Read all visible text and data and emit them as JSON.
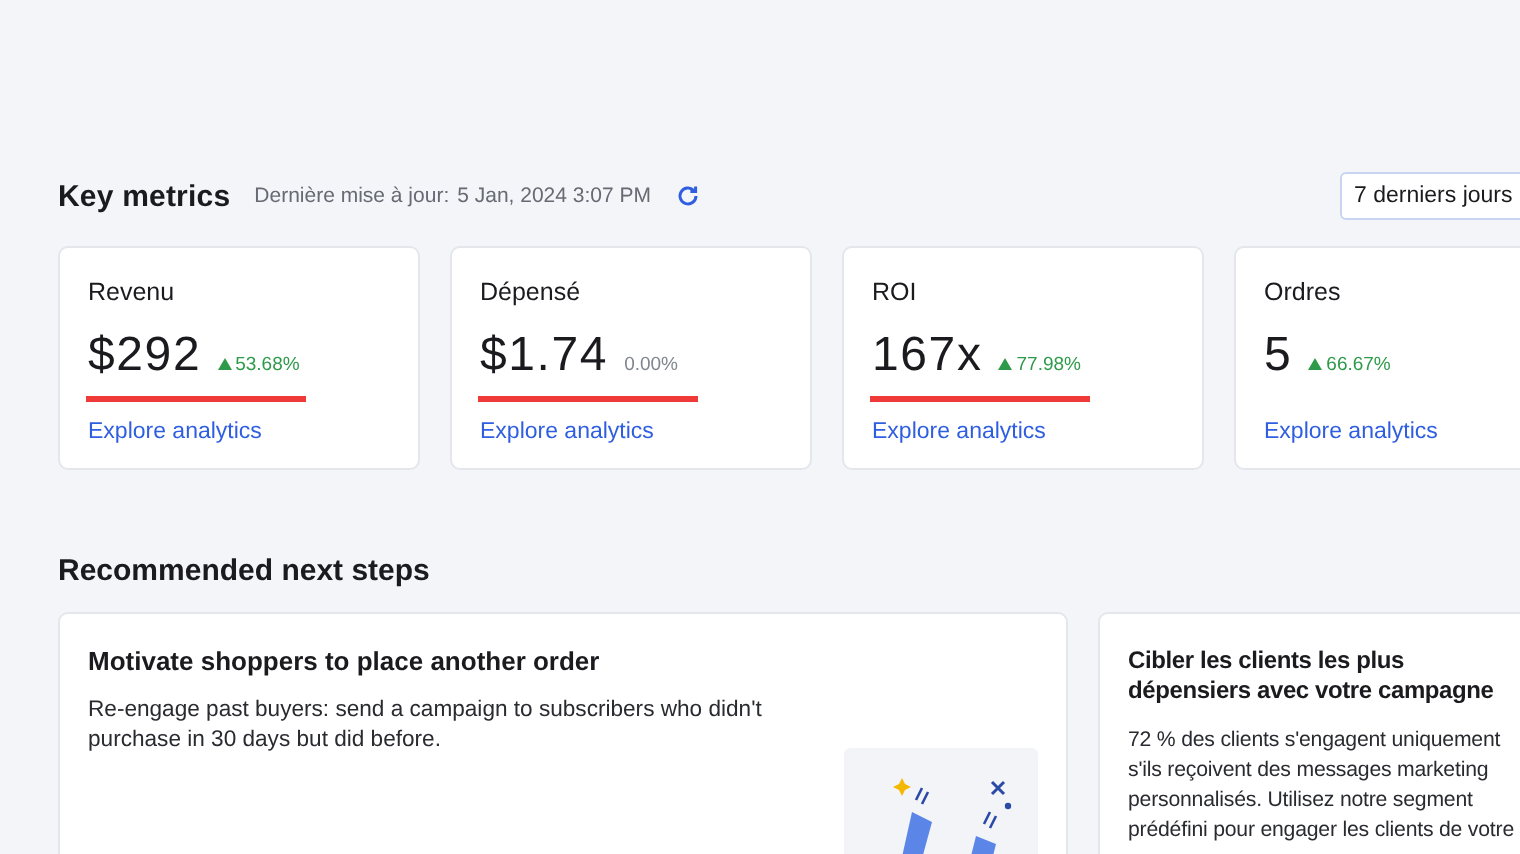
{
  "key_metrics": {
    "title": "Key metrics",
    "updated_label": "Dernière mise à jour:",
    "updated_value": "5 Jan, 2024 3:07 PM",
    "period": "7 derniers jours",
    "metrics": [
      {
        "label": "Revenu",
        "value": "$292",
        "change": "53.68%",
        "kind": "up",
        "underlined": true,
        "link": "Explore analytics"
      },
      {
        "label": "Dépensé",
        "value": "$1.74",
        "change": "0.00%",
        "kind": "flat",
        "underlined": true,
        "link": "Explore analytics"
      },
      {
        "label": "ROI",
        "value": "167x",
        "change": "77.98%",
        "kind": "up",
        "underlined": true,
        "link": "Explore analytics"
      },
      {
        "label": "Ordres",
        "value": "5",
        "change": "66.67%",
        "kind": "up",
        "underlined": false,
        "link": "Explore analytics"
      }
    ]
  },
  "next_steps": {
    "title": "Recommended next steps",
    "cards": [
      {
        "title": "Motivate shoppers to place another order",
        "body": "Re-engage past buyers: send a campaign to subscribers who didn't purchase in 30 days but did before.",
        "kind": "illustrated"
      },
      {
        "title": "Cibler les clients les plus dépensiers avec votre campagne",
        "body": "72 % des clients s'engagent uniquement s'ils reçoivent des messages marketing personnalisés. Utilisez notre segment prédéfini pour engager les clients de votre",
        "kind": "text"
      }
    ]
  }
}
